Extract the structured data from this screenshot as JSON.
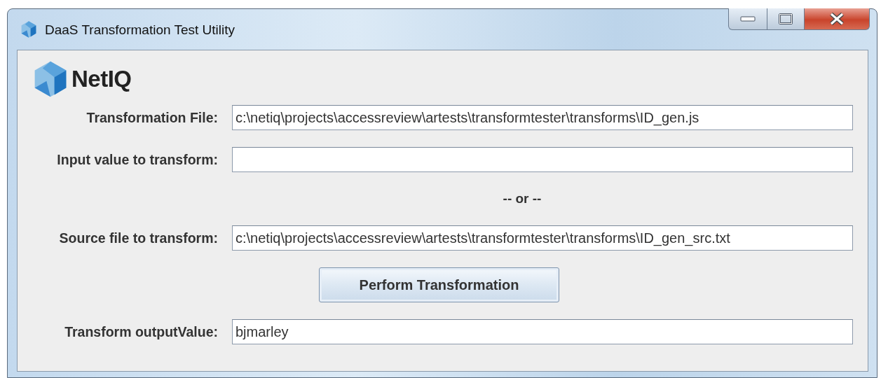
{
  "window": {
    "title": "DaaS Transformation Test Utility"
  },
  "logo": {
    "text": "NetIQ"
  },
  "rows": [
    {
      "kind": "field",
      "label": "Transformation File:",
      "value": "c:\\netiq\\projects\\accessreview\\artests\\transformtester\\transforms\\ID_gen.js"
    },
    {
      "kind": "field",
      "label": "Input value to transform:"
    },
    {
      "kind": "separator",
      "text": "-- or --"
    },
    {
      "kind": "field",
      "label": "Source file to transform:",
      "value": "c:\\netiq\\projects\\accessreview\\artests\\transformtester\\transforms\\ID_gen_src.txt"
    },
    {
      "kind": "button",
      "label": "Perform Transformation"
    },
    {
      "kind": "field",
      "label": "Transform outputValue:",
      "value": "bjmarley"
    }
  ]
}
